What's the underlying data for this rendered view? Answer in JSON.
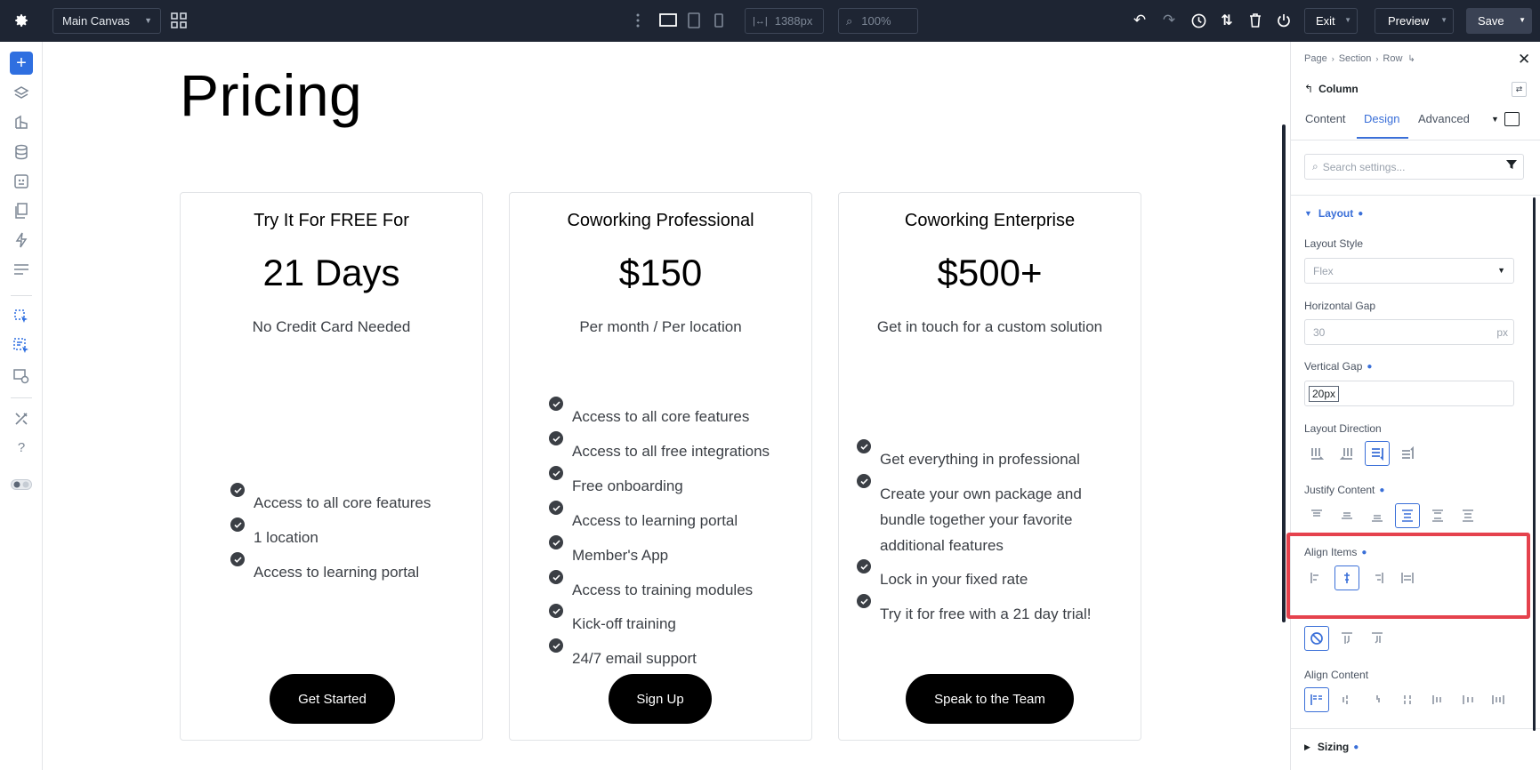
{
  "topbar": {
    "canvas_select": "Main Canvas",
    "width_readout": "1388px",
    "zoom_readout": "100%",
    "exit_label": "Exit",
    "preview_label": "Preview",
    "save_label": "Save"
  },
  "page": {
    "title": "Pricing"
  },
  "cards": [
    {
      "subtitle": "Try It For FREE For",
      "price": "21 Days",
      "desc": "No Credit Card Needed",
      "features": [
        "Access to all core features",
        "1 location",
        "Access to learning portal"
      ],
      "cta": "Get Started"
    },
    {
      "subtitle": "Coworking Professional",
      "price": "$150",
      "desc": "Per month / Per location",
      "features": [
        "Access to all core features",
        "Access to all free integrations",
        "Free onboarding",
        "Access to learning portal",
        "Member's App",
        "Access to training modules",
        "Kick-off training",
        "24/7 email support"
      ],
      "cta": "Sign Up"
    },
    {
      "subtitle": "Coworking Enterprise",
      "price": "$500+",
      "desc": "Get in touch for a custom solution",
      "features": [
        "Get everything in professional",
        "Create your own package and",
        "bundle together your favorite",
        "additional features",
        "Lock in your fixed rate",
        "Try it for free with a 21 day trial!"
      ],
      "cta": "Speak to the Team"
    }
  ],
  "panel": {
    "breadcrumb": [
      "Page",
      "Section",
      "Row"
    ],
    "element_title": "Column",
    "tabs": [
      "Content",
      "Design",
      "Advanced"
    ],
    "search_placeholder": "Search settings...",
    "section_layout": "Layout",
    "layout_style_label": "Layout Style",
    "layout_style_value": "Flex",
    "h_gap_label": "Horizontal Gap",
    "h_gap_value": "30",
    "h_gap_unit": "px",
    "v_gap_label": "Vertical Gap",
    "v_gap_value": "20px",
    "layout_direction_label": "Layout Direction",
    "justify_label": "Justify Content",
    "align_items_label": "Align Items",
    "align_content_label": "Align Content",
    "section_sizing": "Sizing"
  },
  "colors": {
    "accent": "#3a6fd8",
    "topbar": "#1e2533",
    "highlight": "#e5424d"
  }
}
